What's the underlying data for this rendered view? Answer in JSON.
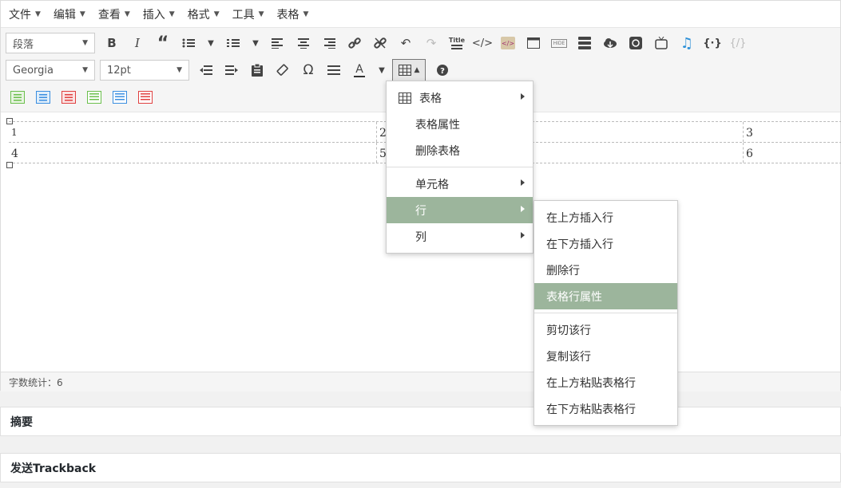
{
  "menubar": {
    "items": [
      "文件",
      "编辑",
      "查看",
      "插入",
      "格式",
      "工具",
      "表格"
    ]
  },
  "toolbar": {
    "block_format": "段落",
    "font_family": "Georgia",
    "font_size": "12pt",
    "title_icon_label": "Title",
    "hide_icon_label": "HIDE"
  },
  "table": {
    "rows": [
      [
        "1",
        "2",
        "3"
      ],
      [
        "4",
        "5",
        "6"
      ]
    ]
  },
  "status": {
    "word_count": "字数统计：6"
  },
  "table_menu": {
    "items": [
      "表格",
      "表格属性",
      "删除表格",
      "单元格",
      "行",
      "列"
    ]
  },
  "row_submenu": {
    "items": [
      "在上方插入行",
      "在下方插入行",
      "删除行",
      "表格行属性",
      "剪切该行",
      "复制该行",
      "在上方粘贴表格行",
      "在下方粘贴表格行"
    ]
  },
  "panels": {
    "excerpt": "摘要",
    "trackback": "发送Trackback"
  },
  "colors": {
    "highlight": "#9cb59c"
  }
}
